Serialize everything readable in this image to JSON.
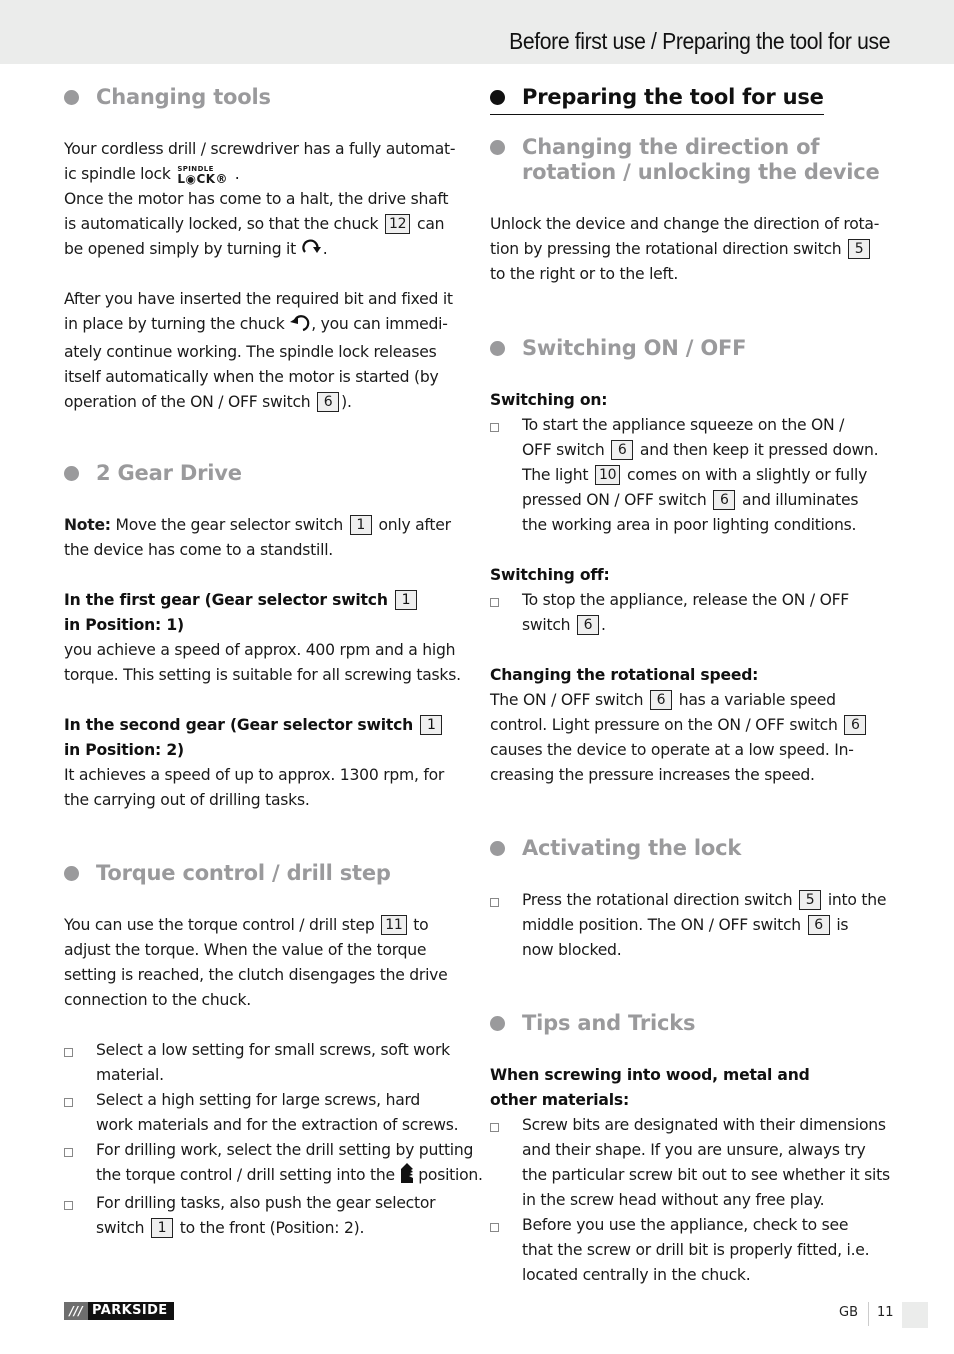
{
  "header": {
    "title": "Before first use / Preparing the tool for use"
  },
  "left": {
    "changing_tools": {
      "heading": "Changing tools",
      "p1_l1": "Your cordless drill / screwdriver has a fully automat-",
      "p1_l2": "ic spindle lock",
      "lock_logo_top": "SPINDLE",
      "lock_logo_bottom": "L◉CK®",
      "p1_l2_end": " .",
      "p1_l3": "Once the motor has come to a halt, the drive shaft",
      "p1_l4a": "is automatically locked, so that the chuck",
      "ref_chuck": "12",
      "p1_l4b": "can",
      "p1_l5a": "be opened simply by turning it",
      "p1_l5b": ".",
      "p2_l1": "After you have inserted the required bit and fixed it",
      "p2_l2a": "in place by turning the chuck",
      "p2_l2b": ", you can immedi-",
      "p2_l3": "ately continue working. The spindle lock releases",
      "p2_l4": "itself automatically when the motor is started (by",
      "p2_l5a": "operation of the ON / OFF switch",
      "ref_switch": "6",
      "p2_l5b": ")."
    },
    "gear_drive": {
      "heading": "2 Gear Drive",
      "note_label": "Note:",
      "note_l1a": " Move the gear selector switch",
      "ref_gear": "1",
      "note_l1b": "only after",
      "note_l2": "the device has come to a standstill.",
      "first_h1": "In the first gear (Gear selector switch",
      "first_h2": "in Position: 1)",
      "first_l1": "you achieve a speed of approx. 400 rpm and a high",
      "first_l2": "torque. This setting is suitable for all screwing tasks.",
      "second_h1": "In the second gear (Gear selector switch",
      "second_h2": "in Position: 2)",
      "second_l1": "It achieves a speed of up to approx. 1300 rpm, for",
      "second_l2": "the carrying out of drilling tasks."
    },
    "torque": {
      "heading": "Torque control / drill step",
      "p_l1a": "You can use the torque control / drill step",
      "ref_torque": "11",
      "p_l1b": "to",
      "p_l2": "adjust the torque. When the value of the torque",
      "p_l3": "setting is reached, the clutch disengages the drive",
      "p_l4": "connection to the chuck.",
      "items": [
        {
          "l1": "Select a low setting for small screws, soft work",
          "l2": "material."
        },
        {
          "l1": "Select a high setting for large screws, hard",
          "l2": "work materials and for the extraction of screws."
        },
        {
          "l1": "For drilling work, select the drill setting by putting",
          "l2a": "the torque control / drill setting into the",
          "l2b": " position."
        },
        {
          "l1": "For drilling tasks, also push the gear selector",
          "l2a": "switch",
          "ref": "1",
          "l2b": "to the front (Position: 2)."
        }
      ]
    }
  },
  "right": {
    "preparing": {
      "heading": "Preparing the tool for use"
    },
    "direction": {
      "heading_l1": "Changing the direction of",
      "heading_l2": "rotation / unlocking the device",
      "l1": "Unlock the device and change the direction of rota-",
      "l2a": "tion by pressing the rotational direction switch",
      "ref": "5",
      "l3": "to the right or to the left."
    },
    "switching": {
      "heading": "Switching ON / OFF",
      "on_label": "Switching on:",
      "on_l1": "To start the appliance squeeze on the ON /",
      "on_l2a": "OFF switch",
      "on_ref1": "6",
      "on_l2b": "and then keep it pressed down.",
      "on_l3a": "The light",
      "on_ref2": "10",
      "on_l3b": "comes on with a slightly or fully",
      "on_l4a": "pressed ON / OFF switch",
      "on_ref3": "6",
      "on_l4b": "and illuminates",
      "on_l5": "the working area in poor lighting conditions.",
      "off_label": "Switching off:",
      "off_l1": "To stop the appliance, release the ON / OFF",
      "off_l2a": "switch",
      "off_ref": "6",
      "off_l2b": ".",
      "speed_label": "Changing the rotational speed:",
      "speed_l1a": "The ON / OFF switch",
      "speed_ref1": "6",
      "speed_l1b": "has a variable speed",
      "speed_l2a": "control. Light pressure on the ON / OFF switch",
      "speed_ref2": "6",
      "speed_l3": "causes the device to operate at a low speed. In-",
      "speed_l4": "creasing the pressure increases the speed."
    },
    "lock": {
      "heading": "Activating the lock",
      "l1a": "Press the rotational direction switch",
      "ref1": "5",
      "l1b": "into the",
      "l2a": "middle position. The ON / OFF switch",
      "ref2": "6",
      "l2b": "is",
      "l3": "now blocked."
    },
    "tips": {
      "heading": "Tips and Tricks",
      "sub_l1": "When screwing into wood, metal and",
      "sub_l2": "other materials:",
      "items": [
        {
          "l1": "Screw bits are designated with their dimensions",
          "l2": "and their shape. If you are unsure, always try",
          "l3": "the particular screw bit out to see whether it sits",
          "l4": "in the screw head without any free play."
        },
        {
          "l1": "Before you use the appliance, check to see",
          "l2": "that the screw or drill bit is properly fitted, i.e.",
          "l3": "located centrally in the chuck."
        }
      ]
    }
  },
  "footer": {
    "brand_slashes": "///",
    "brand_name": "PARKSIDE",
    "language": "GB",
    "page_number": "11"
  }
}
